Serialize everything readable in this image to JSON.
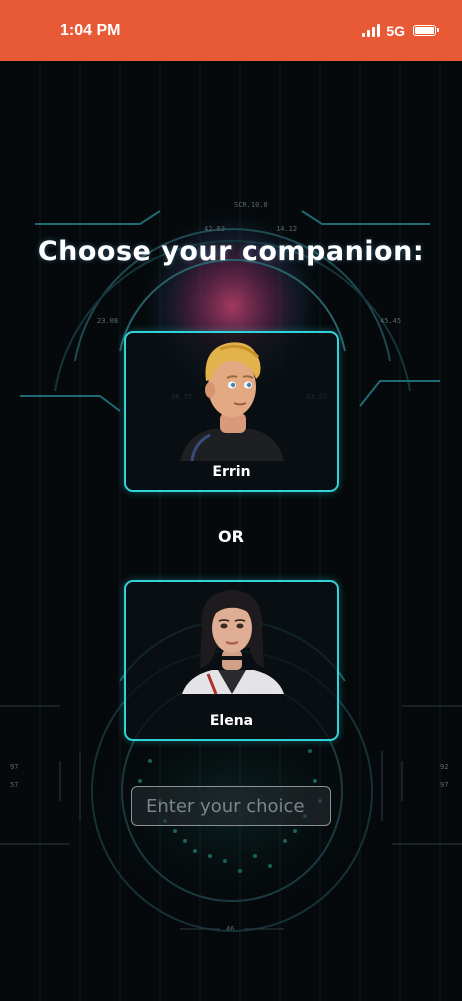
{
  "status_bar": {
    "time": "1:04 PM",
    "network": "5G",
    "icons": [
      "signal-icon",
      "battery-icon"
    ]
  },
  "hud": {
    "labels": [
      "SCR.10.8",
      "42.63",
      "14.12",
      "23.08",
      "45.45",
      "38.75",
      "33.57",
      "46",
      "92",
      "97",
      "57"
    ]
  },
  "page": {
    "title": "Choose your companion:"
  },
  "companions": [
    {
      "name": "Errin"
    },
    {
      "name": "Elena"
    }
  ],
  "separator": "OR",
  "choice_input": {
    "value": "",
    "placeholder": "Enter your choice"
  },
  "colors": {
    "status_bar": "#e85a36",
    "card_border": "#2fd3d8",
    "background": "#05090b"
  }
}
